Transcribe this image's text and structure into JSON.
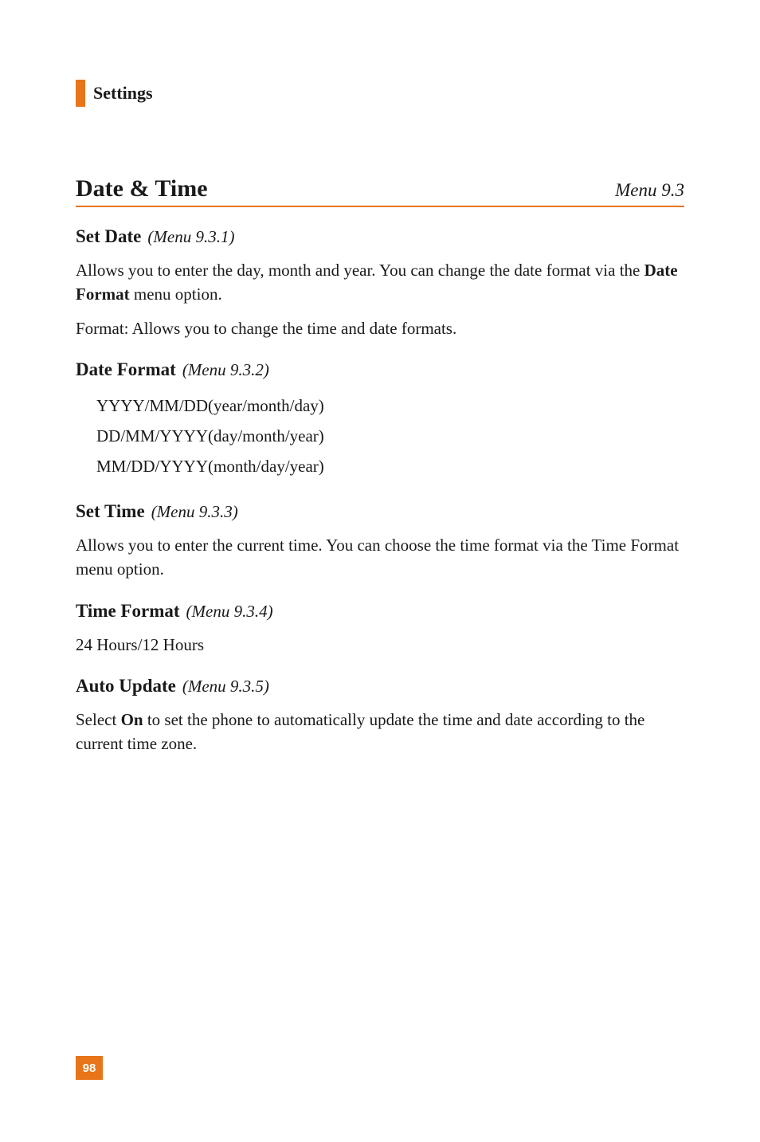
{
  "section_label": "Settings",
  "title": {
    "text": "Date & Time",
    "menu": "Menu 9.3"
  },
  "sub1": {
    "name": "Set Date",
    "menu": "(Menu 9.3.1)",
    "para1_a": "Allows you to enter the day, month and year. You can change the date format via the ",
    "para1_bold": "Date Format",
    "para1_b": " menu option.",
    "para2": "Format: Allows you to change the time and date formats."
  },
  "sub2": {
    "name": "Date Format",
    "menu": "(Menu 9.3.2)",
    "items": {
      "i0": "YYYY/MM/DD(year/month/day)",
      "i1": "DD/MM/YYYY(day/month/year)",
      "i2": "MM/DD/YYYY(month/day/year)"
    }
  },
  "sub3": {
    "name": "Set Time",
    "menu": "(Menu 9.3.3)",
    "para": "Allows you to enter the current time. You can choose the time format via the Time Format menu option."
  },
  "sub4": {
    "name": "Time Format",
    "menu": "(Menu 9.3.4)",
    "para": "24 Hours/12 Hours"
  },
  "sub5": {
    "name": "Auto Update",
    "menu": "(Menu 9.3.5)",
    "para_a": "Select ",
    "para_bold": "On",
    "para_b": " to set the phone to automatically update the time and date according to the current time zone."
  },
  "page_number": "98"
}
